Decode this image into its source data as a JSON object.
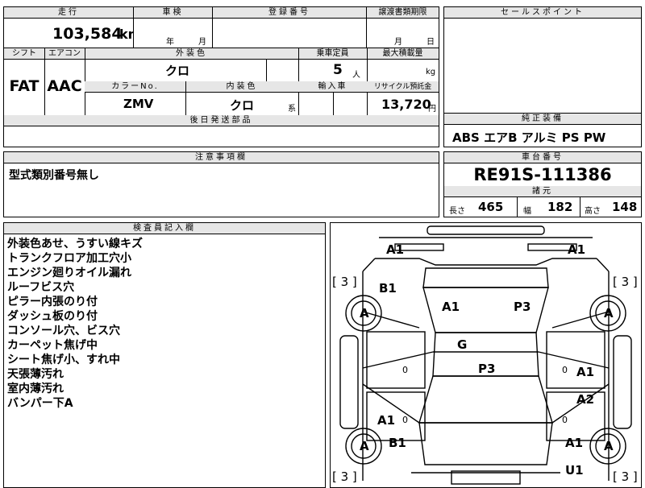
{
  "top": {
    "mileage_label": "走行",
    "mileage_value": "103,584",
    "mileage_unit": "km",
    "inspection_label": "車検",
    "inspection_year": "年",
    "inspection_month": "月",
    "registration_label": "登録番号",
    "transfer_label": "譲渡書類期限",
    "transfer_month": "月",
    "transfer_day": "日",
    "sales_point_label": "セールスポイント"
  },
  "spec": {
    "shift_label": "シフト",
    "aircon_label": "エアコン",
    "exterior_color_label": "外装色",
    "capacity_label": "乗車定員",
    "max_load_label": "最大積載量",
    "shift_value": "FAT",
    "aircon_value": "AAC",
    "exterior_color_value": "クロ",
    "capacity_value": "5",
    "capacity_unit": "人",
    "load_unit": "kg",
    "color_no_label": "カラーNo.",
    "interior_color_label": "内装色",
    "import_label": "輸入車",
    "recycle_label": "リサイクル預託金",
    "color_no_value": "ZMV",
    "interior_color_value": "クロ",
    "interior_color_suffix": "系",
    "recycle_value": "13,720",
    "recycle_unit": "円",
    "later_parts_label": "後日発送部品"
  },
  "equipment": {
    "label": "純正装備",
    "value": "ABS エアB アルミ PS PW"
  },
  "caution": {
    "label": "注意事項欄",
    "text": "型式類別番号無し"
  },
  "chassis": {
    "label": "車台番号",
    "value": "RE91S-111386",
    "dims_label": "諸元",
    "length_label": "長さ",
    "length_value": "465",
    "width_label": "幅",
    "width_value": "182",
    "height_label": "高さ",
    "height_value": "148"
  },
  "inspector": {
    "label": "検査員記入欄",
    "lines": [
      "外装色あせ、うすい線キズ",
      "トランクフロア加工穴小",
      "エンジン廻りオイル漏れ",
      "ルーフビス穴",
      "ピラー内張のり付",
      "ダッシュ板のり付",
      "コンソール穴、ビス穴",
      "カーペット焦げ中",
      "シート焦げ小、すれ中",
      "天張薄汚れ",
      "室内薄汚れ",
      "バンパー下A"
    ]
  },
  "diagram": {
    "tire_grade": "[ 3 ]",
    "wheel_mark": "A",
    "marks": {
      "rear_left": "A1",
      "rear_right": "A1",
      "b1_upper": "B1",
      "trunk_left": "A1",
      "trunk_right": "P3",
      "glass": "G",
      "roof": "P3",
      "zero_left": "0",
      "zero_right": "0",
      "side_right_a1": "A1",
      "side_right_a2": "A2",
      "side_left_a1": "A1",
      "b1_lower": "B1",
      "front_right_a1": "A1",
      "u1": "U1",
      "zero_left2": "0",
      "zero_right2": "0"
    }
  }
}
